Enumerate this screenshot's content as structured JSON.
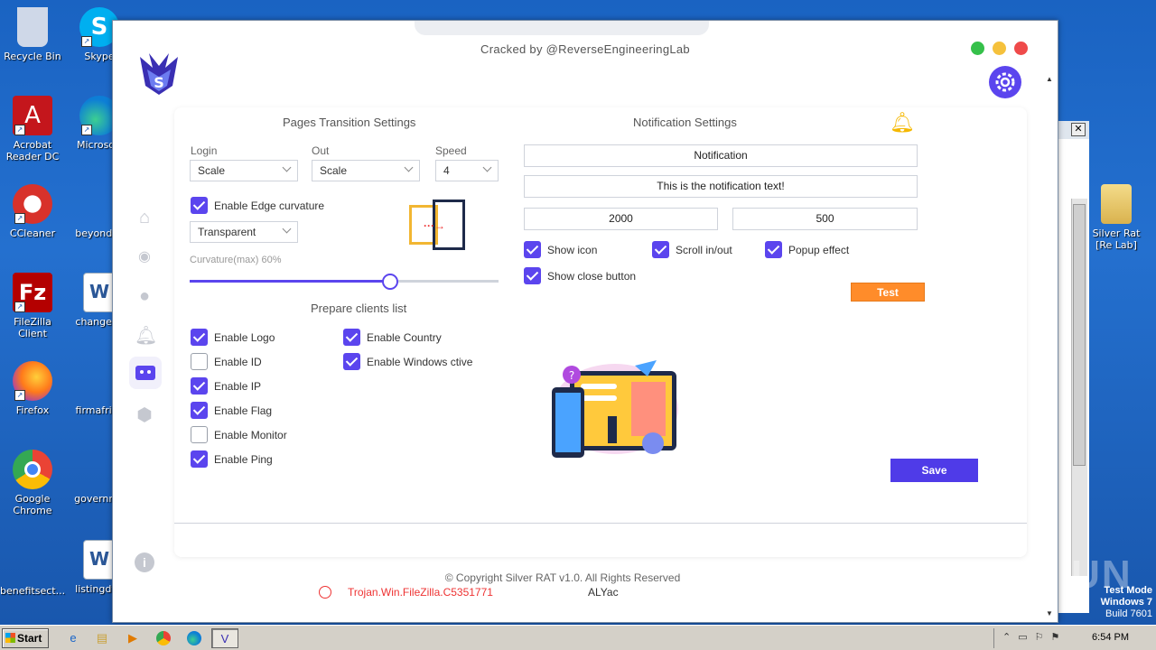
{
  "desktop": {
    "icons": [
      {
        "label": "Recycle Bin",
        "color": "#cfd8e8"
      },
      {
        "label": "Acrobat Reader DC",
        "color": "#c4161c"
      },
      {
        "label": "CCleaner",
        "color": "#d8322b"
      },
      {
        "label": "FileZilla Client",
        "color": "#b40000"
      },
      {
        "label": "Firefox",
        "color": "#ff7a1a"
      },
      {
        "label": "Google Chrome",
        "color": "#4285f4"
      },
      {
        "label": "benefitsect...",
        "color": "#f2f2f2"
      },
      {
        "label": "Skype",
        "color": "#00aff0"
      },
      {
        "label": "Microsoft",
        "color": "#0d7ed6"
      },
      {
        "label": "beyondse",
        "color": "#f2f2f2"
      },
      {
        "label": "changesp",
        "color": "#2b5797"
      },
      {
        "label": "firmafrica",
        "color": "#f2f2f2"
      },
      {
        "label": "governme",
        "color": "#f2f2f2"
      },
      {
        "label": "listingdvd",
        "color": "#2b5797"
      },
      {
        "label": "Silver Rat [Re Lab]",
        "color": "#e8c66a"
      }
    ],
    "watermark": "ANY RUN",
    "os_text": [
      "Test Mode",
      "Windows 7",
      "Build 7601"
    ]
  },
  "app": {
    "title": "Cracked by @ReverseEngineeringLab",
    "transition": {
      "title": "Pages Transition Settings",
      "login_label": "Login",
      "login_value": "Scale",
      "out_label": "Out",
      "out_value": "Scale",
      "speed_label": "Speed",
      "speed_value": "4",
      "edge_curvature": "Enable Edge curvature",
      "style_value": "Transparent",
      "curvature_label": "Curvature(max) 60%",
      "curvature_level": 0.65
    },
    "clients": {
      "title": "Prepare clients list",
      "options": [
        {
          "label": "Enable Logo",
          "checked": true
        },
        {
          "label": "Enable ID",
          "checked": false
        },
        {
          "label": "Enable IP",
          "checked": true
        },
        {
          "label": "Enable Flag",
          "checked": true
        },
        {
          "label": "Enable Monitor",
          "checked": false
        },
        {
          "label": "Enable Ping",
          "checked": true
        },
        {
          "label": "Enable Country",
          "checked": true
        },
        {
          "label": "Enable Windows ctive",
          "checked": true
        }
      ]
    },
    "notification": {
      "title": "Notification Settings",
      "title_value": "Notification",
      "text_value": "This is the notification text!",
      "duration_value": "2000",
      "delay_value": "500",
      "show_icon": "Show icon",
      "scroll": "Scroll in/out",
      "popup": "Popup effect",
      "close_btn": "Show close button",
      "test_label": "Test"
    },
    "save_label": "Save",
    "copyright": "© Copyright Silver RAT v1.0. All Rights Reserved",
    "behind_text": [
      "Trojan.Win.FileZilla.C5351771",
      "ALYac"
    ],
    "colors": {
      "accent": "#5b45ee",
      "test": "#ff8c2a",
      "save": "#4f3be8"
    }
  },
  "taskbar": {
    "start": "Start",
    "clock": "6:54 PM"
  }
}
